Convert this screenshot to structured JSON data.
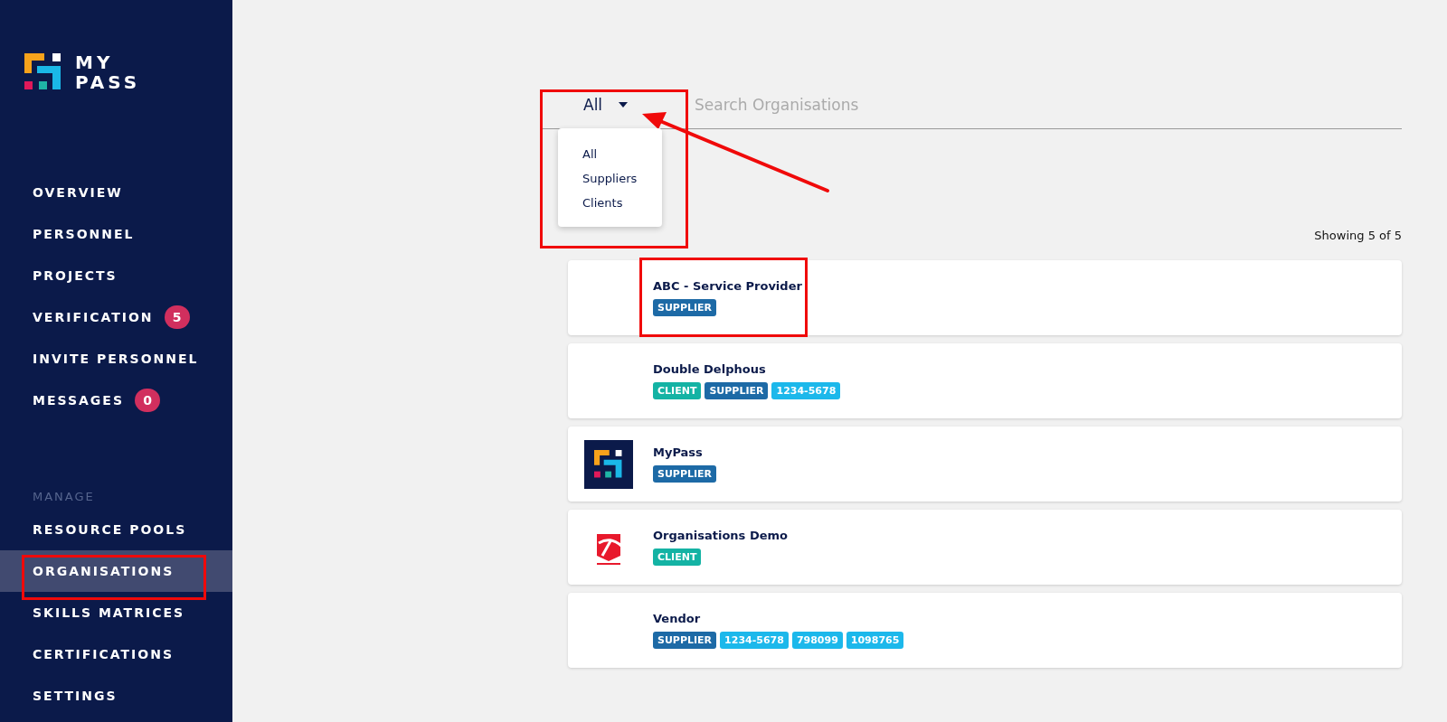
{
  "sidebar": {
    "brand": [
      "MY",
      "PASS"
    ],
    "nav": [
      {
        "label": "OVERVIEW",
        "selected": false
      },
      {
        "label": "PERSONNEL",
        "selected": false
      },
      {
        "label": "PROJECTS",
        "selected": false
      },
      {
        "label": "VERIFICATION",
        "badge": "5",
        "selected": false
      },
      {
        "label": "INVITE PERSONNEL",
        "selected": false
      },
      {
        "label": "MESSAGES",
        "badge": "0",
        "selected": false
      }
    ],
    "section_label": "MANAGE",
    "manage": [
      {
        "label": "RESOURCE POOLS",
        "selected": false
      },
      {
        "label": "ORGANISATIONS",
        "selected": true
      },
      {
        "label": "SKILLS MATRICES",
        "selected": false
      },
      {
        "label": "CERTIFICATIONS",
        "selected": false
      },
      {
        "label": "SETTINGS",
        "selected": false
      }
    ]
  },
  "filter": {
    "value": "All",
    "open": true,
    "options": [
      "All",
      "Suppliers",
      "Clients"
    ]
  },
  "search": {
    "placeholder": "Search Organisations"
  },
  "count": "Showing 5 of 5",
  "organisations": [
    {
      "name": "ABC - Service Provider",
      "kind": "plain",
      "tags": [
        {
          "kind": "supplier",
          "text": "SUPPLIER"
        }
      ]
    },
    {
      "name": "Double Delphous",
      "kind": "plain",
      "tags": [
        {
          "kind": "client",
          "text": "CLIENT"
        },
        {
          "kind": "supplier",
          "text": "SUPPLIER"
        },
        {
          "kind": "code",
          "text": "1234-5678"
        }
      ]
    },
    {
      "name": "MyPass",
      "kind": "mypass",
      "tags": [
        {
          "kind": "supplier",
          "text": "SUPPLIER"
        }
      ]
    },
    {
      "name": "Organisations Demo",
      "kind": "demo",
      "tags": [
        {
          "kind": "client",
          "text": "CLIENT"
        }
      ]
    },
    {
      "name": "Vendor",
      "kind": "plain",
      "tags": [
        {
          "kind": "supplier",
          "text": "SUPPLIER"
        },
        {
          "kind": "code",
          "text": "1234-5678"
        },
        {
          "kind": "code",
          "text": "798099"
        },
        {
          "kind": "code",
          "text": "1098765"
        }
      ]
    }
  ]
}
